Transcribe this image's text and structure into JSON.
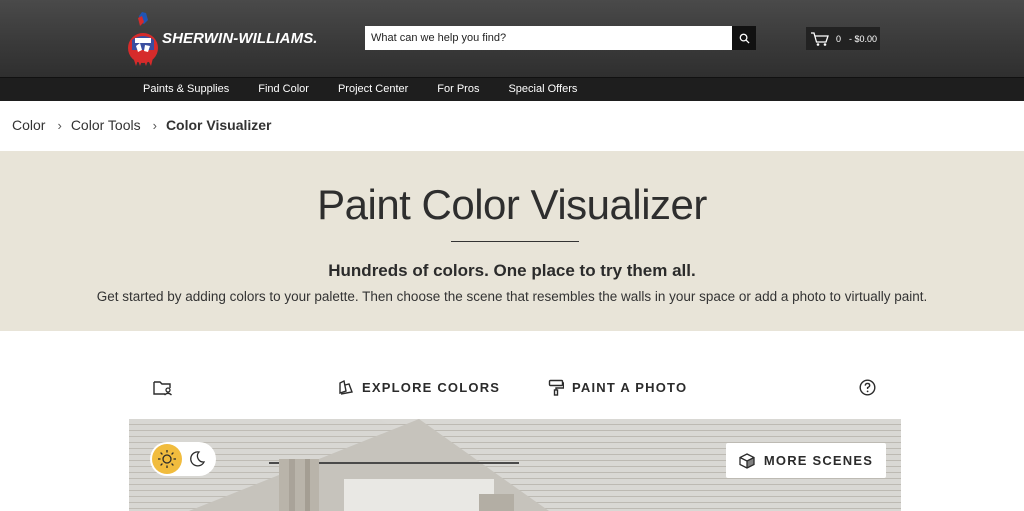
{
  "header": {
    "brand": "SHERWIN-WILLIAMS.",
    "search_placeholder": "What can we help you find?",
    "cart_count": "0",
    "cart_total": "- $0.00"
  },
  "nav": {
    "items": [
      "Paints & Supplies",
      "Find Color",
      "Project Center",
      "For Pros",
      "Special Offers"
    ]
  },
  "breadcrumb": {
    "items": [
      "Color",
      "Color Tools"
    ],
    "current": "Color Visualizer"
  },
  "hero": {
    "title": "Paint Color Visualizer",
    "subtitle": "Hundreds of colors. One place to try them all.",
    "description": "Get started by adding colors to your palette. Then choose the scene that resembles the walls in your space or add a photo to virtually paint."
  },
  "toolbar": {
    "explore_label": "EXPLORE COLORS",
    "paint_photo_label": "PAINT A PHOTO"
  },
  "scene": {
    "more_scenes_label": "MORE SCENES",
    "mode": "day"
  },
  "colors": {
    "header_bg": "#3a3a3a",
    "nav_bg": "#1e1e1e",
    "hero_bg": "#e8e4d8",
    "sun_toggle": "#f1bc3e",
    "brand_red": "#d62b2b"
  }
}
